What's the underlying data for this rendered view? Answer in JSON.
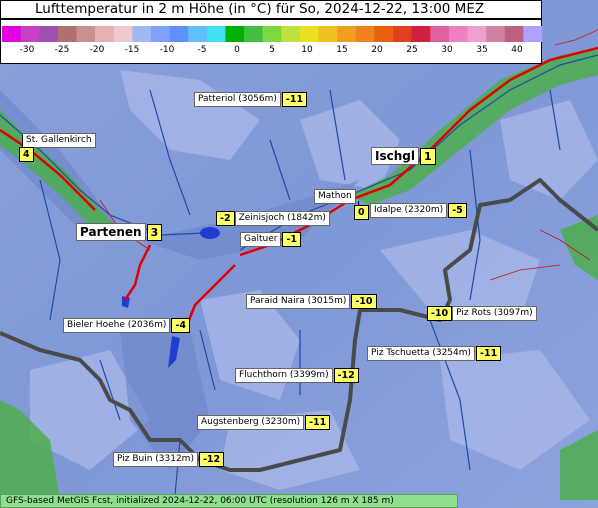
{
  "title": "Lufttemperatur in 2 m Höhe (in °C) für So, 2024-12-22, 13:00 MEZ",
  "legend": {
    "ticks": [
      "-30",
      "-25",
      "-20",
      "-15",
      "-10",
      "-5",
      "0",
      "5",
      "10",
      "15",
      "20",
      "25",
      "30",
      "35",
      "40"
    ],
    "colors": [
      "#e000e0",
      "#c840c8",
      "#a050b0",
      "#b07070",
      "#c89090",
      "#e8b0b0",
      "#f0c8d0",
      "#a0b8f0",
      "#80a0ff",
      "#6090ff",
      "#60c0ff",
      "#40e0f0",
      "#00b000",
      "#40c040",
      "#80d840",
      "#c0e040",
      "#e8e020",
      "#f0c020",
      "#f0a020",
      "#f08020",
      "#e86010",
      "#e04020",
      "#d02040",
      "#e060a0",
      "#f080c0",
      "#f0a0d0",
      "#d080a0",
      "#c06080",
      "#b0a0ff"
    ]
  },
  "locations": [
    {
      "name": "Patteriol (3056m)",
      "value": "-11"
    },
    {
      "name": "St. Gallenkirch",
      "value": "4"
    },
    {
      "name": "Ischgl",
      "value": "1"
    },
    {
      "name": "Mathon",
      "value": "0"
    },
    {
      "name": "Idalpe (2320m)",
      "value": "-5"
    },
    {
      "name": "Zeinisjoch (1842m)",
      "value": "-2"
    },
    {
      "name": "Partenen",
      "value": "3"
    },
    {
      "name": "Galtuer",
      "value": "-1"
    },
    {
      "name": "Paraid Naira (3015m)",
      "value": "-10"
    },
    {
      "name": "Piz Rots (3097m)",
      "value": "-10"
    },
    {
      "name": "Bieler Hoehe (2036m)",
      "value": "-4"
    },
    {
      "name": "Piz Tschuetta (3254m)",
      "value": "-11"
    },
    {
      "name": "Fluchthorn (3399m)",
      "value": "-12"
    },
    {
      "name": "Augstenberg (3230m)",
      "value": "-11"
    },
    {
      "name": "Piz Buin (3312m)",
      "value": "-12"
    }
  ],
  "footer": "GFS-based MetGIS Fcst, initialized 2024-12-22, 06:00 UTC  (resolution 126 m X 185 m)"
}
